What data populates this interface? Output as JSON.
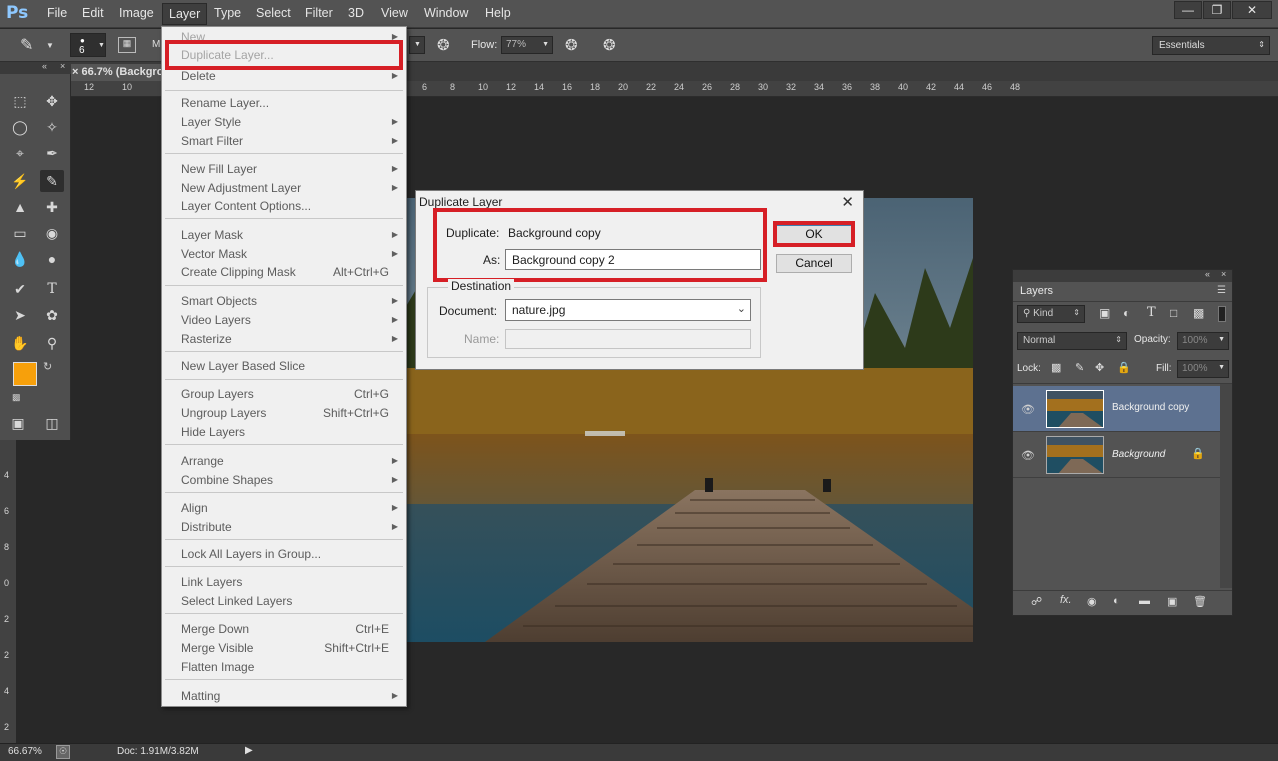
{
  "app": {
    "logo": "Ps",
    "menus": [
      "File",
      "Edit",
      "Image",
      "Layer",
      "Type",
      "Select",
      "Filter",
      "3D",
      "View",
      "Window",
      "Help"
    ],
    "active_menu": "Layer",
    "window_controls": [
      "minimize-icon",
      "restore-icon",
      "close-icon"
    ]
  },
  "options_bar": {
    "brush_size": "6",
    "flow_label": "Flow:",
    "flow_value": "77%",
    "workspace": "Essentials"
  },
  "document": {
    "tab_title": "66.7% (Backgro",
    "ruler_ticks": [
      "12",
      "10",
      "6",
      "8",
      "10",
      "12",
      "14",
      "16",
      "18",
      "20",
      "22",
      "24",
      "26",
      "28",
      "30",
      "32",
      "34",
      "36",
      "38",
      "40",
      "42",
      "44",
      "46",
      "48"
    ],
    "vertical_ruler_ticks": [
      "4",
      "6",
      "8",
      "0",
      "2",
      "2",
      "4",
      "2",
      "6"
    ]
  },
  "layer_menu": {
    "items": [
      {
        "label": "New",
        "dim": true,
        "arrow": true
      },
      {
        "label": "Duplicate Layer...",
        "dim": true
      },
      {
        "label": "Delete",
        "dim": false,
        "arrow": true
      },
      {
        "label": "Rename Layer..."
      },
      {
        "label": "Layer Style",
        "arrow": true
      },
      {
        "label": "Smart Filter",
        "arrow": true
      },
      {
        "label": "New Fill Layer",
        "arrow": true
      },
      {
        "label": "New Adjustment Layer",
        "arrow": true
      },
      {
        "label": "Layer Content Options..."
      },
      {
        "label": "Layer Mask",
        "arrow": true
      },
      {
        "label": "Vector Mask",
        "arrow": true
      },
      {
        "label": "Create Clipping Mask",
        "shortcut": "Alt+Ctrl+G"
      },
      {
        "label": "Smart Objects",
        "arrow": true
      },
      {
        "label": "Video Layers",
        "arrow": true
      },
      {
        "label": "Rasterize",
        "arrow": true
      },
      {
        "label": "New Layer Based Slice"
      },
      {
        "label": "Group Layers",
        "shortcut": "Ctrl+G"
      },
      {
        "label": "Ungroup Layers",
        "shortcut": "Shift+Ctrl+G"
      },
      {
        "label": "Hide Layers"
      },
      {
        "label": "Arrange",
        "arrow": true
      },
      {
        "label": "Combine Shapes",
        "arrow": true
      },
      {
        "label": "Align",
        "arrow": true
      },
      {
        "label": "Distribute",
        "arrow": true
      },
      {
        "label": "Lock All Layers in Group..."
      },
      {
        "label": "Link Layers"
      },
      {
        "label": "Select Linked Layers"
      },
      {
        "label": "Merge Down",
        "shortcut": "Ctrl+E"
      },
      {
        "label": "Merge Visible",
        "shortcut": "Shift+Ctrl+E"
      },
      {
        "label": "Flatten Image"
      },
      {
        "label": "Matting",
        "arrow": true
      }
    ]
  },
  "dialog": {
    "title": "Duplicate Layer",
    "duplicate_label": "Duplicate:",
    "duplicate_value": "Background copy",
    "as_label": "As:",
    "as_value": "Background copy 2",
    "destination_label": "Destination",
    "document_label": "Document:",
    "document_value": "nature.jpg",
    "name_label": "Name:",
    "ok_label": "OK",
    "cancel_label": "Cancel"
  },
  "layers_panel": {
    "tab": "Layers",
    "kind_label": "Kind",
    "blend_mode": "Normal",
    "opacity_label": "Opacity:",
    "opacity_value": "100%",
    "lock_label": "Lock:",
    "fill_label": "Fill:",
    "fill_value": "100%",
    "layers": [
      {
        "name": "Background copy",
        "selected": true
      },
      {
        "name": "Background",
        "selected": false,
        "locked": true
      }
    ]
  },
  "status_bar": {
    "zoom": "66.67%",
    "doc_info": "Doc: 1.91M/3.82M"
  },
  "colors": {
    "foreground": "#f7a00b",
    "background": "#000000",
    "highlight_red": "#d61f26",
    "selected_layer": "#5d7190"
  }
}
